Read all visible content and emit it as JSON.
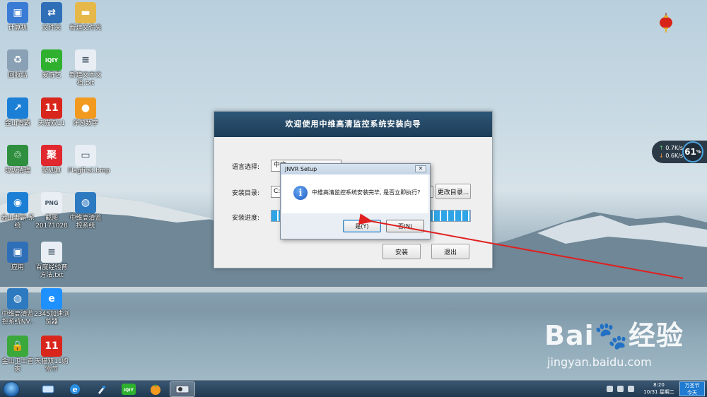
{
  "desktop": {
    "icons": [
      {
        "name": "computer-icon",
        "label": "计算机",
        "color": "#3a7bd5",
        "glyph": "▣"
      },
      {
        "name": "network-icon",
        "label": "文件夹",
        "color": "#2f6fb8",
        "glyph": "⇄"
      },
      {
        "name": "folder-icon",
        "label": "新建文件夹",
        "color": "#e6b84a",
        "glyph": "▬"
      },
      {
        "name": "recycle-bin-icon",
        "label": "回收站",
        "color": "#8aa0b4",
        "glyph": "♻"
      },
      {
        "name": "iqiyi-icon",
        "label": "爱奇艺",
        "color": "#2fb12f",
        "glyph": "iQIY"
      },
      {
        "name": "text-file-icon",
        "label": "新建文本文档.txt",
        "color": "#e8eef3",
        "glyph": "≡"
      },
      {
        "name": "jinshan-icon",
        "label": "金山毒霸",
        "color": "#1c7fd6",
        "glyph": "↗"
      },
      {
        "name": "tmall-icon",
        "label": "天猫双11",
        "color": "#d9261c",
        "glyph": "11"
      },
      {
        "name": "onion-icon",
        "label": "洋葱数字",
        "color": "#f29a1f",
        "glyph": "●"
      },
      {
        "name": "trash-icon",
        "label": "垃圾清理",
        "color": "#2f8f3f",
        "glyph": "♲"
      },
      {
        "name": "juhuasuan-icon",
        "label": "聚划算",
        "color": "#e0282e",
        "glyph": "聚"
      },
      {
        "name": "bitmap-icon",
        "label": "Flagfirst.bmp",
        "color": "#e8eef3",
        "glyph": "▭"
      },
      {
        "name": "weather-icon",
        "label": "金山毒霸·系统",
        "color": "#1c7fd6",
        "glyph": "◉"
      },
      {
        "name": "screenshot-icon",
        "label": "截图 20171028",
        "color": "#e8eef3",
        "glyph": "PNG"
      },
      {
        "name": "nvr-icon",
        "label": "中维高清监控系统",
        "color": "#2d7ac0",
        "glyph": "◍"
      },
      {
        "name": "apps-icon",
        "label": "应用",
        "color": "#2f6fb8",
        "glyph": "▣"
      },
      {
        "name": "doc-icon",
        "label": "百度经验育方法.txt",
        "color": "#e8eef3",
        "glyph": "≡"
      },
      {
        "name": "nvr2-icon",
        "label": "中维高清监控系统NV..",
        "color": "#2d7ac0",
        "glyph": "◍"
      },
      {
        "name": "browser-icon",
        "label": "2345加速浏览器",
        "color": "#1e90ff",
        "glyph": "e"
      },
      {
        "name": "security-icon",
        "label": "金山卫士管家",
        "color": "#3aa83a",
        "glyph": "🔒"
      },
      {
        "name": "tmall2-icon",
        "label": "天猫双11购物节",
        "color": "#d9261c",
        "glyph": "11"
      }
    ]
  },
  "netwidget": {
    "up": "0.7K/s",
    "down": "0.6K/s",
    "percent": "61",
    "percent_suffix": "%"
  },
  "installer": {
    "title": "欢迎使用中维高清监控系统安装向导",
    "language_label": "语言选择:",
    "language_value": "中文",
    "dir_label": "安装目录:",
    "dir_value": "C:\\",
    "change_dir_button": "更改目录...",
    "progress_label": "安装进度:",
    "progress": 1.0,
    "install_button": "安装",
    "exit_button": "退出"
  },
  "dialog": {
    "title": "JNVR Setup",
    "close": "✕",
    "message": "中维高清监控系统安装完毕, 是否立即执行?",
    "yes_button": "是(Y)",
    "no_button": "否(N)"
  },
  "taskbar": {
    "time": "8:20",
    "date": "10/31 星期二",
    "holiday": "万圣节",
    "holiday_sub": "今天"
  },
  "watermark": {
    "logo": "Bai🐾经验",
    "url": "jingyan.baidu.com"
  },
  "colors": {
    "accent": "#1d3d57",
    "progress": "#2fa5e7",
    "arrow": "#e02020"
  }
}
